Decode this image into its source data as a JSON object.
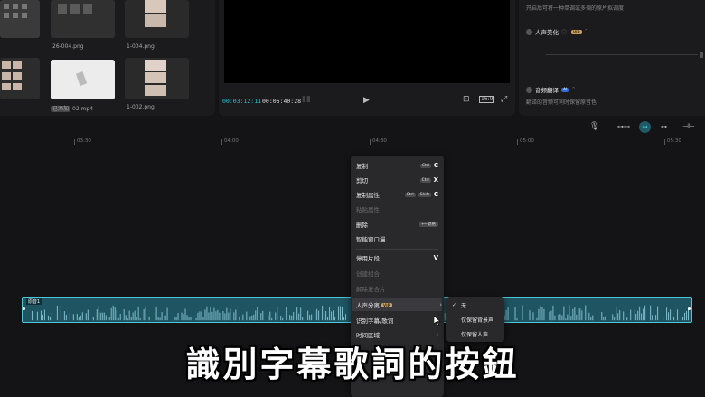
{
  "media": {
    "items": [
      {
        "label": "26-004.png"
      },
      {
        "label": "1-004.png"
      },
      {
        "label": "02.mp4",
        "badge": "已添加"
      },
      {
        "label": "1-002.png"
      }
    ]
  },
  "preview": {
    "current_time": "00:03:12:11",
    "duration": "00:06:40:28",
    "ratio_label": "16:9"
  },
  "properties": {
    "top_hint": "开启后可将一种单调或多调的原片拟调度",
    "voice_beauty_label": "人声美化",
    "voice_beauty_vip": "VIP",
    "translate_label": "音频翻译",
    "translate_badge": "AI",
    "translate_hint": "翻译的音频可同时保留原音色"
  },
  "ruler": {
    "labels": [
      "03:30",
      "04:00",
      "04:30",
      "05:00",
      "05:30"
    ]
  },
  "track": {
    "label": "原音1"
  },
  "context_menu": {
    "copy": "复制",
    "copy_mod": "Ctrl",
    "copy_key": "C",
    "cut": "剪切",
    "cut_mod": "Ctrl",
    "cut_key": "X",
    "copy_attr": "复制属性",
    "copy_attr_mod1": "Ctrl",
    "copy_attr_mod2": "Shift",
    "copy_attr_key": "C",
    "paste_attr": "粘贴属性",
    "delete": "删除",
    "delete_key": "⟵退格",
    "smart_window": "智能窗口漫",
    "disable_clip": "停用片段",
    "disable_key": "V",
    "create_group": "创建组合",
    "ungroup": "解除复合片",
    "voice_sep": "人声分离",
    "voice_sep_vip": "VIP",
    "recognize": "识别字幕/歌词",
    "time_region": "时间区域"
  },
  "submenu": {
    "none": "无",
    "keep_bg": "仅保留背景声",
    "keep_voice": "仅保留人声"
  },
  "caption": {
    "text": "識別字幕歌詞的按鈕"
  },
  "colors": {
    "accent": "#27c4d6",
    "vip": "#c9a25f",
    "track": "#1f5563"
  }
}
